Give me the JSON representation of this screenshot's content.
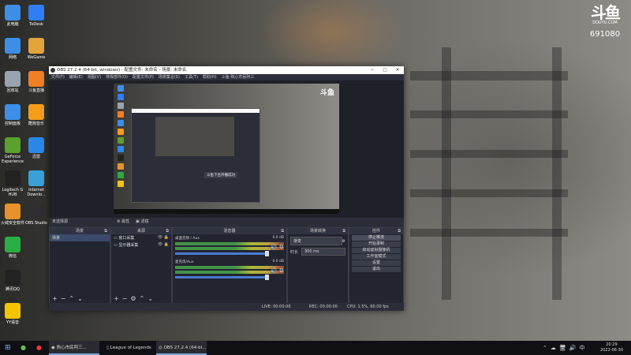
{
  "desktop": {
    "icons_col1": [
      {
        "label": "此电脑",
        "color": "#3d8ee6"
      },
      {
        "label": "网络",
        "color": "#3d8ee6"
      },
      {
        "label": "回收站",
        "color": "#9aa4b0"
      },
      {
        "label": "控制面板",
        "color": "#3d8ee6"
      },
      {
        "label": "GeForce Experience",
        "color": "#5aa02c"
      },
      {
        "label": "Logitech G HUB",
        "color": "#222222"
      },
      {
        "label": "火绒安全软件",
        "color": "#e8912a"
      },
      {
        "label": "微信",
        "color": "#2aae43"
      },
      {
        "label": "腾讯QQ",
        "color": "#222222"
      },
      {
        "label": "YY语音",
        "color": "#f5c400"
      }
    ],
    "icons_col2": [
      {
        "label": "ToDesk",
        "color": "#2f7ef5"
      },
      {
        "label": "WeGame",
        "color": "#e2a33a"
      },
      {
        "label": "斗鱼直播",
        "color": "#f08025"
      },
      {
        "label": "酷狗音乐",
        "color": "#f59c1a"
      },
      {
        "label": "迅雷",
        "color": "#2b87e8"
      },
      {
        "label": "Internet Downlo...",
        "color": "#3aa0d8"
      },
      {
        "label": "OBS Studio",
        "color": "#302e31"
      }
    ]
  },
  "watermark": {
    "logo": "斗鱼",
    "site": "DOUYU.COM",
    "room": "691080"
  },
  "obs": {
    "title": "OBS 27.2.4 (64-bit, windows) - 配置文件: 未命名 - 场景: 未命名",
    "menu": [
      "文件(F)",
      "编辑(E)",
      "视图(V)",
      "停靠部件(D)",
      "配置文件(P)",
      "场景集合(S)",
      "工具(T)",
      "帮助(H)",
      "斗鱼-热心市民阿三"
    ],
    "nested_message": "斗鱼下台开播成功",
    "scene_label": "未选择源",
    "scene_btn_props": "属性",
    "scene_btn_filters": "滤镜",
    "docks": {
      "scenes": {
        "title": "场景",
        "items": [
          "场景"
        ]
      },
      "sources": {
        "title": "来源",
        "items": [
          "窗口采集",
          "显示器采集"
        ]
      },
      "mixer": {
        "title": "混音器",
        "channels": [
          {
            "name": "桌面音频 / Aux",
            "db": "0.0 dB"
          },
          {
            "name": "麦克风/Aux",
            "db": "0.0 dB"
          }
        ]
      },
      "transitions": {
        "title": "场景转换",
        "type": "渐变",
        "duration_label": "时长",
        "duration": "300 ms"
      },
      "controls": {
        "title": "控件",
        "buttons": [
          "停止推流",
          "开始录制",
          "启动虚拟摄像机",
          "工作室模式",
          "设置",
          "退出"
        ]
      }
    },
    "status": {
      "live": "LIVE: 00:00:00",
      "rec": "REC: 00:00:00",
      "cpu": "CPU: 1.5%, 60.00 fps"
    }
  },
  "taskbar": {
    "items": [
      {
        "label": "热心市民阿三..."
      },
      {
        "label": "League of Legends"
      },
      {
        "label": "OBS 27.2.4 (64-bi..."
      }
    ],
    "time": "20:29",
    "date": "2022-06-30"
  }
}
